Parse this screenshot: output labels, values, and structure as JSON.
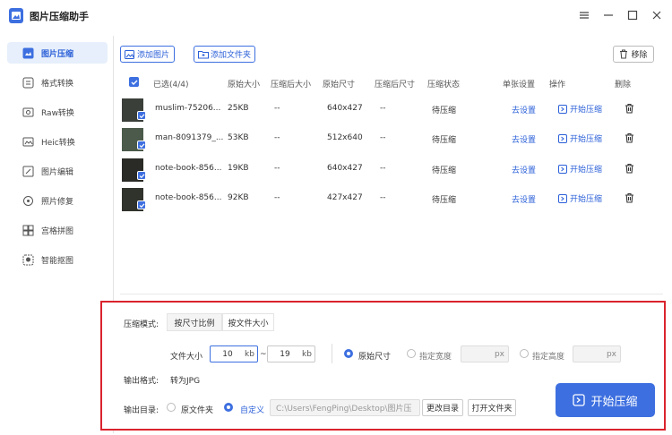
{
  "app": {
    "title": "图片压缩助手",
    "icons": [
      "app-logo",
      "menu-icon",
      "minimize-icon",
      "maximize-icon",
      "close-icon"
    ]
  },
  "sidebar": {
    "items": [
      {
        "label": "图片压缩",
        "icon": "compress-icon",
        "active": true
      },
      {
        "label": "格式转换",
        "icon": "format-icon"
      },
      {
        "label": "Raw转换",
        "icon": "raw-icon"
      },
      {
        "label": "Heic转换",
        "icon": "heic-icon"
      },
      {
        "label": "图片编辑",
        "icon": "edit-icon"
      },
      {
        "label": "照片修复",
        "icon": "repair-icon"
      },
      {
        "label": "宫格拼图",
        "icon": "grid-icon"
      },
      {
        "label": "智能抠图",
        "icon": "cutout-icon"
      }
    ]
  },
  "toolbar": {
    "add_image": "添加图片",
    "add_folder": "添加文件夹",
    "remove": "移除"
  },
  "table": {
    "headers": {
      "selected": "已选(4/4)",
      "original_size": "原始大小",
      "compressed_size": "压缩后大小",
      "original_dims": "原始尺寸",
      "compressed_dims": "压缩后尺寸",
      "status": "压缩状态",
      "single_setting": "单张设置",
      "operation": "操作",
      "delete": "删除"
    },
    "rows": [
      {
        "name": "muslim-75206...",
        "size": "25KB",
        "csize": "--",
        "dims": "640x427",
        "cdims": "--",
        "status": "待压缩",
        "setting": "去设置",
        "op": "开始压缩",
        "thumb": "#3a3f3a"
      },
      {
        "name": "man-8091379_...",
        "size": "53KB",
        "csize": "--",
        "dims": "512x640",
        "cdims": "--",
        "status": "待压缩",
        "setting": "去设置",
        "op": "开始压缩",
        "thumb": "#4b5a4a"
      },
      {
        "name": "note-book-856...",
        "size": "19KB",
        "csize": "--",
        "dims": "640x427",
        "cdims": "--",
        "status": "待压缩",
        "setting": "去设置",
        "op": "开始压缩",
        "thumb": "#2a2a26"
      },
      {
        "name": "note-book-856...",
        "size": "92KB",
        "csize": "--",
        "dims": "427x427",
        "cdims": "--",
        "status": "待压缩",
        "setting": "去设置",
        "op": "开始压缩",
        "thumb": "#30332c"
      }
    ]
  },
  "settings": {
    "mode_label": "压缩模式:",
    "mode_tabs": [
      "按尺寸比例",
      "按文件大小"
    ],
    "active_mode": 1,
    "file_size_label": "文件大小",
    "min_value": "10",
    "min_unit": "kb",
    "tilde": "~",
    "max_value": "19",
    "max_unit": "kb",
    "dim_options": [
      "原始尺寸",
      "指定宽度",
      "指定高度"
    ],
    "dim_selected": 0,
    "width_unit": "px",
    "height_unit": "px",
    "output_format_label": "输出格式:",
    "output_format_value": "转为JPG",
    "output_dir_label": "输出目录:",
    "dir_options": [
      "原文件夹",
      "自定义"
    ],
    "dir_selected": 1,
    "path": "C:\\Users\\FengPing\\Desktop\\图片压",
    "change_dir": "更改目录",
    "open_folder": "打开文件夹",
    "start": "开始压缩"
  },
  "colors": {
    "accent": "#3d6fe0",
    "highlight_border": "#d9232e",
    "active_bg": "#e6effb"
  }
}
